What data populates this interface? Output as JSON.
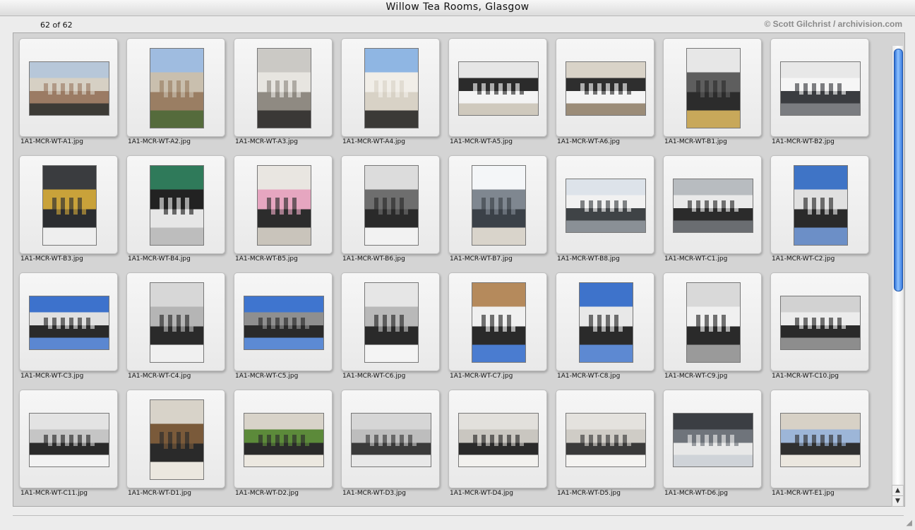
{
  "window": {
    "title": "Willow Tea Rooms, Glasgow"
  },
  "counter": "62 of 62",
  "credit": "© Scott Gilchrist / archivision.com",
  "thumbnails": [
    {
      "file": "1A1-MCR-WT-A1.jpg",
      "orient": "land",
      "palette": [
        "#b7c7d9",
        "#9b7b64",
        "#d6d0c4",
        "#3d3b36"
      ]
    },
    {
      "file": "1A1-MCR-WT-A2.jpg",
      "orient": "port",
      "palette": [
        "#9fbce0",
        "#9a7e63",
        "#c9bfae",
        "#556b3c"
      ]
    },
    {
      "file": "1A1-MCR-WT-A3.jpg",
      "orient": "port",
      "palette": [
        "#cbc9c5",
        "#8f8a82",
        "#e7e5e0",
        "#3a3836"
      ]
    },
    {
      "file": "1A1-MCR-WT-A4.jpg",
      "orient": "port",
      "palette": [
        "#8fb6e3",
        "#d8d2c6",
        "#f1eee8",
        "#3b3a37"
      ]
    },
    {
      "file": "1A1-MCR-WT-A5.jpg",
      "orient": "land",
      "palette": [
        "#e6e6e6",
        "#f3f3f3",
        "#2b2b2b",
        "#cfc9bd"
      ]
    },
    {
      "file": "1A1-MCR-WT-A6.jpg",
      "orient": "land",
      "palette": [
        "#d9d3c8",
        "#f4f4f4",
        "#2e2e2e",
        "#9b8c78"
      ]
    },
    {
      "file": "1A1-MCR-WT-B1.jpg",
      "orient": "port",
      "palette": [
        "#e7e7e7",
        "#2c2c2c",
        "#5e5e5e",
        "#c8a85a"
      ]
    },
    {
      "file": "1A1-MCR-WT-B2.jpg",
      "orient": "land",
      "palette": [
        "#e8e8e8",
        "#3a3c40",
        "#f6f6f6",
        "#7a7c80"
      ]
    },
    {
      "file": "1A1-MCR-WT-B3.jpg",
      "orient": "port",
      "palette": [
        "#3a3c3f",
        "#2b2d30",
        "#c9a23a",
        "#eeeeee"
      ]
    },
    {
      "file": "1A1-MCR-WT-B4.jpg",
      "orient": "port",
      "palette": [
        "#2f7a5a",
        "#e6e6e6",
        "#222222",
        "#bdbdbd"
      ]
    },
    {
      "file": "1A1-MCR-WT-B5.jpg",
      "orient": "port",
      "palette": [
        "#e9e6e1",
        "#2c2c2c",
        "#e6a6c0",
        "#c9c4bb"
      ]
    },
    {
      "file": "1A1-MCR-WT-B6.jpg",
      "orient": "port",
      "palette": [
        "#dcdcdc",
        "#2a2a2a",
        "#6e6e6e",
        "#f2f2f2"
      ]
    },
    {
      "file": "1A1-MCR-WT-B7.jpg",
      "orient": "port",
      "palette": [
        "#f4f6f8",
        "#3b4148",
        "#7f8790",
        "#d9d4cb"
      ]
    },
    {
      "file": "1A1-MCR-WT-B8.jpg",
      "orient": "land",
      "palette": [
        "#dde3ea",
        "#3f4346",
        "#f1f1f1",
        "#8a9096"
      ]
    },
    {
      "file": "1A1-MCR-WT-C1.jpg",
      "orient": "land",
      "palette": [
        "#b8bcc0",
        "#2b2b2b",
        "#e9e9e9",
        "#6a6d71"
      ]
    },
    {
      "file": "1A1-MCR-WT-C2.jpg",
      "orient": "port",
      "palette": [
        "#3f74c6",
        "#2a2a2a",
        "#e0e0e0",
        "#6c8fc7"
      ]
    },
    {
      "file": "1A1-MCR-WT-C3.jpg",
      "orient": "land",
      "palette": [
        "#3d72cc",
        "#2a2a2a",
        "#e0e0e0",
        "#5b87d1"
      ]
    },
    {
      "file": "1A1-MCR-WT-C4.jpg",
      "orient": "port",
      "palette": [
        "#d7d7d7",
        "#2a2a2a",
        "#b5b5b5",
        "#f0f0f0"
      ]
    },
    {
      "file": "1A1-MCR-WT-C5.jpg",
      "orient": "land",
      "palette": [
        "#3f75cf",
        "#2a2a2a",
        "#8f8f8f",
        "#5c8ad4"
      ]
    },
    {
      "file": "1A1-MCR-WT-C6.jpg",
      "orient": "port",
      "palette": [
        "#e6e6e6",
        "#2a2a2a",
        "#b9b9b9",
        "#f4f4f4"
      ]
    },
    {
      "file": "1A1-MCR-WT-C7.jpg",
      "orient": "port",
      "palette": [
        "#b58a5c",
        "#2a2a2a",
        "#f0f0f0",
        "#4a7cd0"
      ]
    },
    {
      "file": "1A1-MCR-WT-C8.jpg",
      "orient": "port",
      "palette": [
        "#3e73cb",
        "#2a2a2a",
        "#e8e8e8",
        "#5d89d2"
      ]
    },
    {
      "file": "1A1-MCR-WT-C9.jpg",
      "orient": "port",
      "palette": [
        "#d9d9d9",
        "#2a2a2a",
        "#f0f0f0",
        "#9a9a9a"
      ]
    },
    {
      "file": "1A1-MCR-WT-C10.jpg",
      "orient": "land",
      "palette": [
        "#d2d2d2",
        "#2a2a2a",
        "#ececec",
        "#8d8d8d"
      ]
    },
    {
      "file": "1A1-MCR-WT-C11.jpg",
      "orient": "land",
      "palette": [
        "#e3e3e3",
        "#2a2a2a",
        "#c5c5c5",
        "#f2f2f2"
      ]
    },
    {
      "file": "1A1-MCR-WT-D1.jpg",
      "orient": "port",
      "palette": [
        "#d8d3c9",
        "#2a2a2a",
        "#7a5a3a",
        "#ebe7df"
      ]
    },
    {
      "file": "1A1-MCR-WT-D2.jpg",
      "orient": "land",
      "palette": [
        "#d8d3c9",
        "#2a2a2a",
        "#5c8a3a",
        "#ece8e0"
      ]
    },
    {
      "file": "1A1-MCR-WT-D3.jpg",
      "orient": "land",
      "palette": [
        "#d6d6d6",
        "#3a3a3a",
        "#bdbdbd",
        "#e8e8e8"
      ]
    },
    {
      "file": "1A1-MCR-WT-D4.jpg",
      "orient": "land",
      "palette": [
        "#e2e0dc",
        "#2a2a2a",
        "#c9c6c0",
        "#f2f1ee"
      ]
    },
    {
      "file": "1A1-MCR-WT-D5.jpg",
      "orient": "land",
      "palette": [
        "#e4e2de",
        "#3a3a3a",
        "#cfccc6",
        "#f4f3f1"
      ]
    },
    {
      "file": "1A1-MCR-WT-D6.jpg",
      "orient": "land",
      "palette": [
        "#3b3e43",
        "#e8e8e8",
        "#6f747b",
        "#cfd3d8"
      ]
    },
    {
      "file": "1A1-MCR-WT-E1.jpg",
      "orient": "land",
      "palette": [
        "#d7d1c6",
        "#2f2f2f",
        "#9db6d8",
        "#ebe7df"
      ]
    }
  ],
  "icons": {
    "scroll_up": "▲",
    "scroll_down": "▼",
    "resize_grip": "◢"
  }
}
